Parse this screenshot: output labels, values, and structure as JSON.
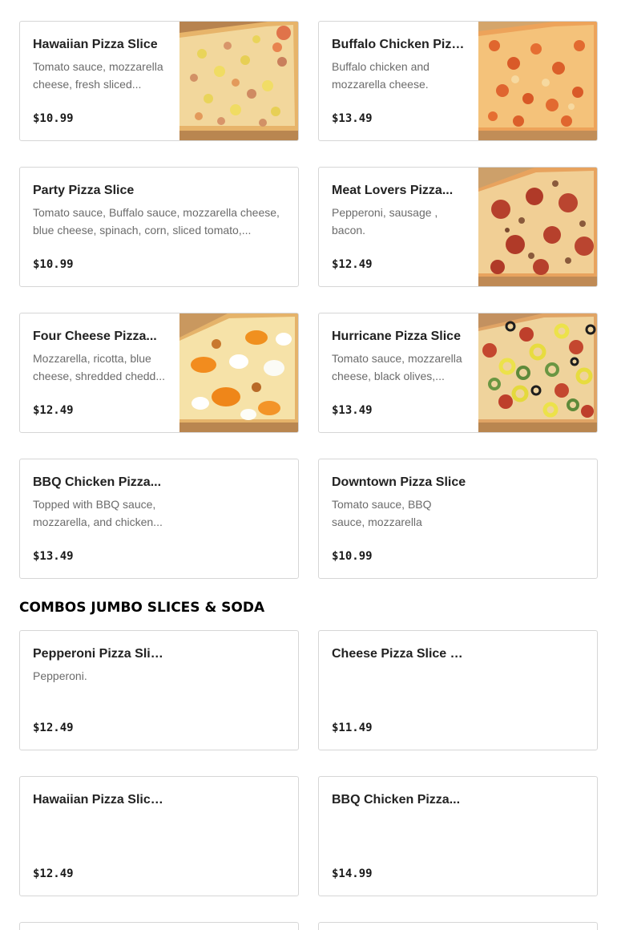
{
  "menu_items": [
    {
      "name": "Hawaiian Pizza Slice",
      "description": "Tomato sauce, mozzarella cheese, fresh sliced...",
      "price": "$10.99",
      "image": "pizza-photo-hawaiian"
    },
    {
      "name": "Buffalo Chicken Pizz...",
      "description": "Buffalo chicken and mozzarella cheese.",
      "price": "$13.49",
      "image": "pizza-photo-buffalo-chicken"
    },
    {
      "name": "Party Pizza Slice",
      "description": "Tomato sauce, Buffalo sauce, mozzarella cheese, blue cheese, spinach, corn, sliced tomato,...",
      "price": "$10.99",
      "image": ""
    },
    {
      "name": "Meat Lovers Pizza...",
      "description": "Pepperoni, sausage , bacon.",
      "price": "$12.49",
      "image": "pizza-photo-meat-lovers"
    },
    {
      "name": "Four Cheese Pizza...",
      "description": "Mozzarella, ricotta, blue cheese, shredded chedd...",
      "price": "$12.49",
      "image": "pizza-photo-four-cheese"
    },
    {
      "name": "Hurricane Pizza Slice",
      "description": "Tomato sauce, mozzarella cheese, black olives,...",
      "price": "$13.49",
      "image": "pizza-photo-hurricane"
    },
    {
      "name": "BBQ Chicken Pizza...",
      "description": "Topped with BBQ sauce, mozzarella, and chicken...",
      "price": "$13.49",
      "image": ""
    },
    {
      "name": "Downtown Pizza Slice",
      "description": "Tomato sauce, BBQ sauce, mozzarella chees...",
      "price": "$10.99",
      "image": ""
    }
  ],
  "combos_section": {
    "title": "COMBOS JUMBO SLICES & SODA",
    "items": [
      {
        "name": "Pepperoni Pizza Slic...",
        "description": "Pepperoni.",
        "price": "$12.49"
      },
      {
        "name": "Cheese Pizza Slice &...",
        "description": "",
        "price": "$11.49"
      },
      {
        "name": "Hawaiian Pizza Slice ...",
        "description": "",
        "price": "$12.49"
      },
      {
        "name": "BBQ Chicken Pizza...",
        "description": "",
        "price": "$14.99"
      }
    ]
  },
  "colors": {
    "card_border": "#d6d6d6",
    "name_text": "#222222",
    "description_text": "#6b6b6b",
    "price_text": "#1a1a1a",
    "heading_text": "#000000"
  }
}
